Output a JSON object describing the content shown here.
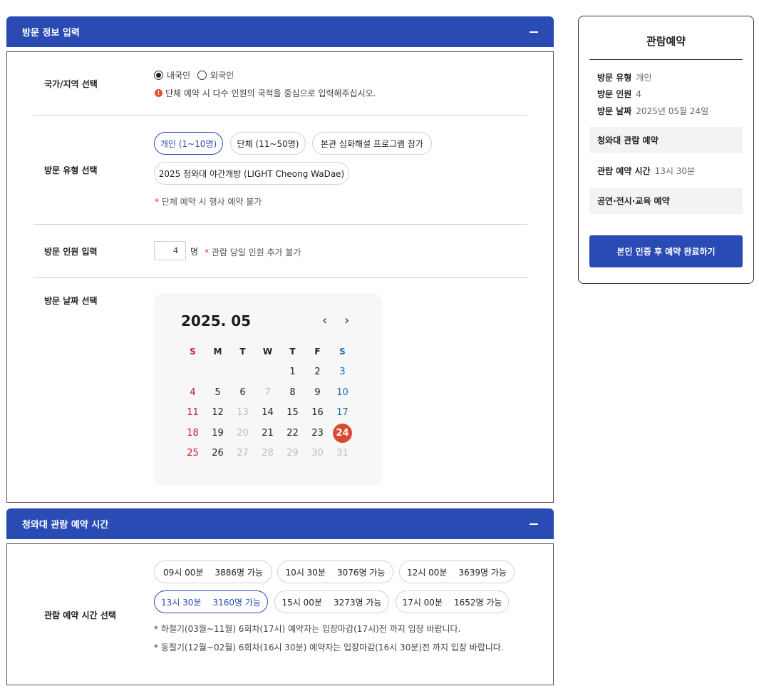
{
  "visit_info": {
    "header": "방문 정보 입력",
    "country": {
      "label": "국가/지역 선택",
      "options": [
        "내국인",
        "외국인"
      ],
      "selected": "내국인",
      "notice": "단체 예약 시 다수 인원의 국적을 중심으로 입력해주십시오.",
      "notice_icon": "!"
    },
    "type": {
      "label": "방문 유형 선택",
      "options": [
        "개인 (1~10명)",
        "단체 (11~50명)",
        "본관 심화해설 프로그램 참가",
        "2025 청와대 야간개방 (LIGHT Cheong WaDae)"
      ],
      "selected": "개인 (1~10명)",
      "note_star": "*",
      "note": " 단체 예약 시 행사 예약 불가"
    },
    "count": {
      "label": "방문 인원 입력",
      "value": "4",
      "unit": "명",
      "note_star": "*",
      "note": " 관람 당일 인원 추가 불가"
    },
    "date": {
      "label": "방문 날짜 선택",
      "calendar_title": "2025. 05",
      "prev": "‹",
      "next": "›",
      "weekdays": [
        "S",
        "M",
        "T",
        "W",
        "T",
        "F",
        "S"
      ],
      "weeks": [
        [
          "",
          "",
          "",
          "",
          "1",
          "2",
          "3"
        ],
        [
          "4",
          "5",
          "6",
          "7",
          "8",
          "9",
          "10"
        ],
        [
          "11",
          "12",
          "13",
          "14",
          "15",
          "16",
          "17"
        ],
        [
          "18",
          "19",
          "20",
          "21",
          "22",
          "23",
          "24"
        ],
        [
          "25",
          "26",
          "27",
          "28",
          "29",
          "30",
          "31"
        ]
      ],
      "unavailable": [
        "7",
        "13",
        "20",
        "27",
        "28",
        "29",
        "30",
        "31"
      ],
      "selected": "24"
    }
  },
  "time_section": {
    "header": "청와대 관람 예약 시간",
    "label": "관람 예약 시간 선택",
    "slots": [
      {
        "time": "09시 00분",
        "capacity": "3886명 가능"
      },
      {
        "time": "10시 30분",
        "capacity": "3076명 가능"
      },
      {
        "time": "12시 00분",
        "capacity": "3639명 가능"
      },
      {
        "time": "13시 30분",
        "capacity": "3160명 가능"
      },
      {
        "time": "15시 00분",
        "capacity": "3273명 가능"
      },
      {
        "time": "17시 00분",
        "capacity": "1652명 가능"
      }
    ],
    "selected_index": 3,
    "notes": [
      "* 하절기(03월~11월) 6회차(17시) 예약자는 입장마감(17시)전 까지 입장 바랍니다.",
      "* 동절기(12월~02월) 6회차(16시 30분) 예약자는 입장마감(16시 30분)전 까지 입장 바랍니다."
    ]
  },
  "sidebar": {
    "title": "관람예약",
    "visit_type_label": "방문 유형",
    "visit_type_value": "개인",
    "count_label": "방문 인원",
    "count_value": "4",
    "date_label": "방문 날짜",
    "date_value": "2025년 05월 24일",
    "box1": "청와대 관람 예약",
    "time_label": "관람 예약 시간",
    "time_value": "13시 30분",
    "box2": "공연·전시·교육 예약",
    "button": "본인 인증 후 예약 완료하기"
  },
  "colors": {
    "accent": "#2a4bb3",
    "selected_date": "#d94a35",
    "sunday": "#c41e2b",
    "saturday": "#1f6cb0"
  }
}
